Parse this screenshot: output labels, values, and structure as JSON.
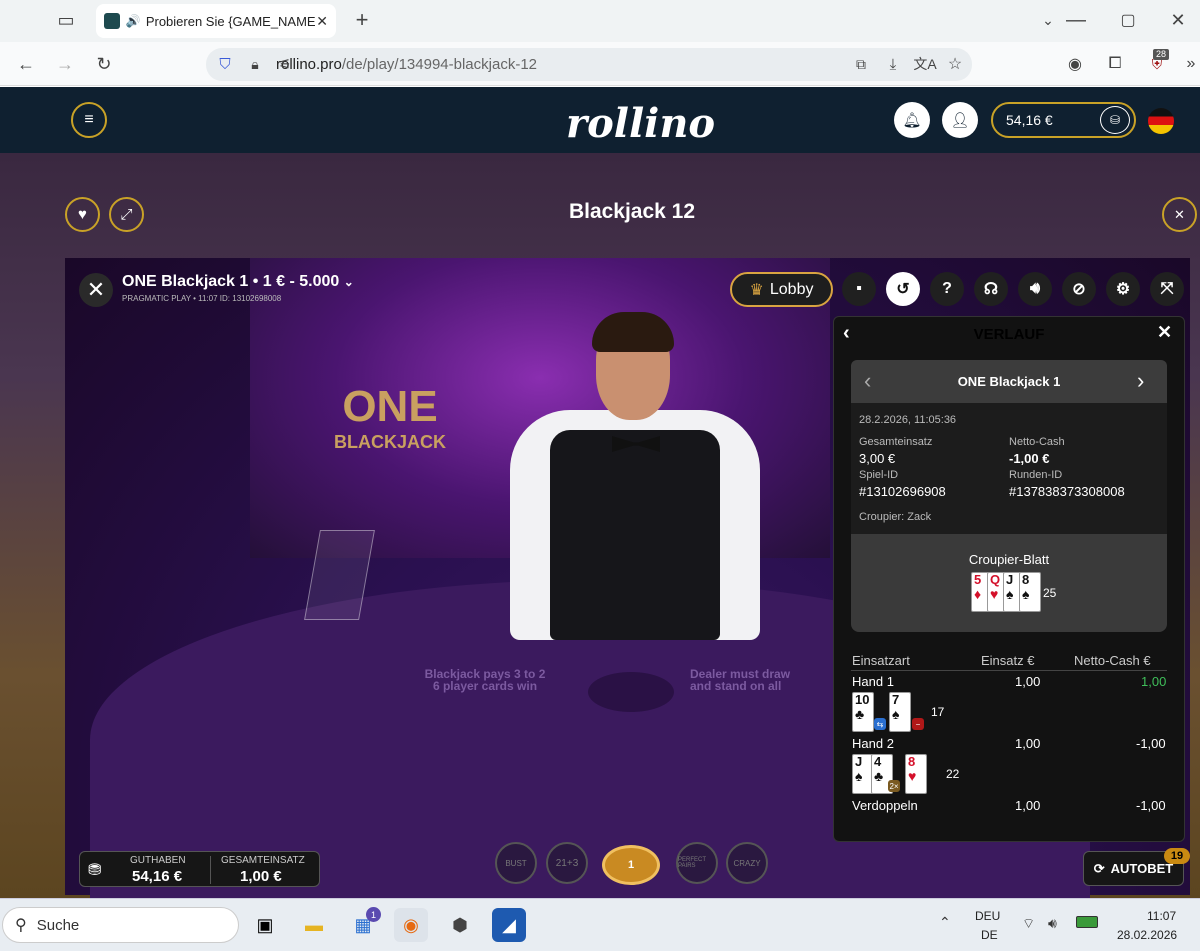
{
  "browser": {
    "tab_title": "Probieren Sie {GAME_NAME",
    "url_domain": "rollino.pro",
    "url_path": "/de/play/134994-blackjack-12",
    "extension_badge": "28"
  },
  "site": {
    "logo": "rollino",
    "balance": "54,16 €"
  },
  "page": {
    "game_title": "Blackjack 12"
  },
  "game": {
    "name": "ONE Blackjack 1 • 1 € - 5.000",
    "subinfo": "PRAGMATIC PLAY • 11:07 ID: 13102698008",
    "lobby_label": "Lobby",
    "brand_line1": "ONE",
    "brand_line2": "BLACKJACK",
    "table_text_left1": "Blackjack pays 3 to 2",
    "table_text_left2": "6 player cards win",
    "table_text_right1": "Dealer must draw",
    "table_text_right2": "and stand on all",
    "chip_value": "1",
    "chips": [
      "BUST",
      "21+3",
      "PERFECT PAIRS",
      "CRAZY"
    ]
  },
  "history": {
    "title": "VERLAUF",
    "game_name": "ONE Blackjack 1",
    "datetime": "28.2.2026, 11:05:36",
    "total_bet_label": "Gesamteinsatz",
    "total_bet": "3,00 €",
    "net_cash_label": "Netto-Cash",
    "net_cash": "-1,00 €",
    "game_id_label": "Spiel-ID",
    "game_id": "#13102696908",
    "round_id_label": "Runden-ID",
    "round_id": "#137838373308008",
    "croupier": "Croupier: Zack",
    "dealer_hand_label": "Croupier-Blatt",
    "dealer_total": "25",
    "dealer_cards": [
      {
        "rank": "5",
        "suit": "♦",
        "color": "red"
      },
      {
        "rank": "Q",
        "suit": "♥",
        "color": "red"
      },
      {
        "rank": "J",
        "suit": "♠",
        "color": "black"
      },
      {
        "rank": "8",
        "suit": "♠",
        "color": "black"
      }
    ],
    "col_type": "Einsatzart",
    "col_bet": "Einsatz €",
    "col_net": "Netto-Cash €",
    "rows": [
      {
        "type": "Hand 1",
        "bet": "1,00",
        "net": "1,00",
        "net_color": "#3fbf5a",
        "total": "17",
        "cards": [
          {
            "rank": "10",
            "suit": "♣",
            "color": "black"
          },
          {
            "rank": "7",
            "suit": "♠",
            "color": "black"
          }
        ]
      },
      {
        "type": "Hand 2",
        "bet": "1,00",
        "net": "-1,00",
        "net_color": "#ffffff",
        "total": "22",
        "cards": [
          {
            "rank": "J",
            "suit": "♠",
            "color": "black"
          },
          {
            "rank": "4",
            "suit": "♣",
            "color": "black"
          },
          {
            "rank": "8",
            "suit": "♥",
            "color": "red"
          }
        ]
      },
      {
        "type": "Verdoppeln",
        "bet": "1,00",
        "net": "-1,00",
        "net_color": "#ffffff"
      }
    ]
  },
  "bottom": {
    "balance_label": "GUTHABEN",
    "balance_value": "54,16 €",
    "total_bet_label": "GESAMTEINSATZ",
    "total_bet_value": "1,00 €",
    "autobet_label": "AUTOBET",
    "autobet_badge": "19"
  },
  "taskbar": {
    "search_placeholder": "Suche",
    "store_badge": "1",
    "lang1": "DEU",
    "lang2": "DE",
    "time": "11:07",
    "date": "28.02.2026"
  }
}
